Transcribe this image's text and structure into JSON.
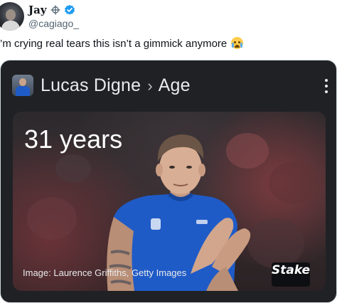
{
  "tweet": {
    "display_name": "Jay",
    "handle": "@cagiago_",
    "text": "’m crying real tears this isn’t a gimmick anymore",
    "emoji_icon": "loudly-crying-face-icon"
  },
  "card": {
    "entity": "Lucas Digne",
    "separator": "›",
    "attribute": "Age",
    "answer": "31 years",
    "caption": "Image: Laurence Griffiths, Getty Images",
    "watermark": "Stake",
    "colors": {
      "card_bg": "#202124",
      "jersey_blue": "#1f5bc7",
      "verified_blue": "#1d9bf0"
    }
  }
}
